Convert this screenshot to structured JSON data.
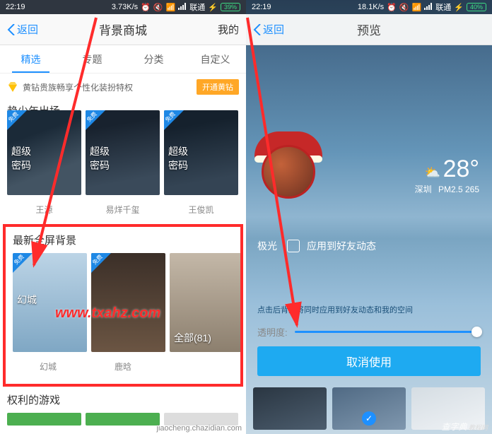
{
  "left": {
    "status": {
      "time": "22:19",
      "speed": "3.73K/s",
      "carrier": "联通",
      "battery": "39%"
    },
    "nav": {
      "back": "返回",
      "title": "背景商城",
      "right": "我的"
    },
    "tabs": [
      "精选",
      "专题",
      "分类",
      "自定义"
    ],
    "vip": {
      "text": "黄钻贵族畅享个性化装扮特权",
      "button": "开通黄钻"
    },
    "row1": {
      "cards": [
        {
          "overlay": "超级\n密码",
          "label": "王源"
        },
        {
          "overlay": "超级\n密码",
          "label": "易烊千玺"
        },
        {
          "overlay": "超级\n密码",
          "label": "王俊凯"
        }
      ]
    },
    "section2": {
      "title": "最新全屏背景",
      "cards": [
        {
          "overlay": "幻城",
          "label": "幻城",
          "ribbon": "免费"
        },
        {
          "overlay": "",
          "label": "鹿晗",
          "ribbon": "免费"
        },
        {
          "overlay": "全部(81)",
          "label": "",
          "ribbon": ""
        }
      ]
    },
    "section3": {
      "title": "权利的游戏"
    }
  },
  "right": {
    "status": {
      "time": "22:19",
      "speed": "18.1K/s",
      "carrier": "联通",
      "battery": "40%"
    },
    "nav": {
      "back": "返回",
      "title": "预览"
    },
    "weather": {
      "temp": "28°",
      "city": "深圳",
      "pm": "PM2.5 265"
    },
    "chk": {
      "name": "极光",
      "label": "应用到好友动态"
    },
    "tip": "点击后背景将同时应用到好友动态和我的空间",
    "slider": {
      "label": "透明度:"
    },
    "button": "取消使用"
  },
  "watermarks": {
    "txahz": "www.txahz.com",
    "site1": "查字典",
    "site2": "jiaocheng.chazidian.com"
  }
}
